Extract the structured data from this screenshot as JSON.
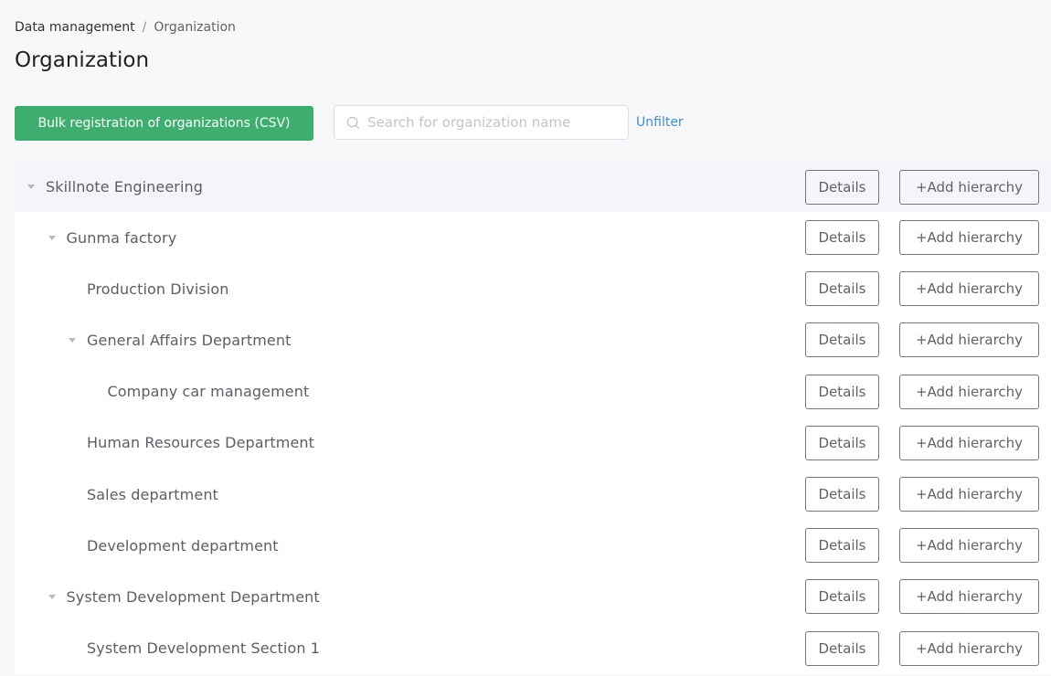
{
  "breadcrumb": {
    "items": [
      {
        "label": "Data management"
      },
      {
        "label": "Organization"
      }
    ],
    "separator": "/"
  },
  "page": {
    "title": "Organization"
  },
  "toolbar": {
    "bulk_register_label": "Bulk registration of organizations (CSV)",
    "search_placeholder": "Search for organization name",
    "search_value": "",
    "unfilter_label": "Unfilter"
  },
  "colors": {
    "primary_green": "#3dae6e",
    "link_blue": "#3d8fd6",
    "page_background": "#f7f8fa"
  },
  "tree": {
    "details_label": "Details",
    "add_hierarchy_label": "+Add hierarchy",
    "nodes": [
      {
        "label": "Skillnote Engineering",
        "level": 0,
        "expandable": true,
        "expanded": true
      },
      {
        "label": "Gunma factory",
        "level": 1,
        "expandable": true,
        "expanded": true
      },
      {
        "label": "Production Division",
        "level": 2,
        "expandable": false
      },
      {
        "label": "General Affairs Department",
        "level": 2,
        "expandable": true,
        "expanded": true
      },
      {
        "label": "Company car management",
        "level": 3,
        "expandable": false
      },
      {
        "label": "Human Resources Department",
        "level": 2,
        "expandable": false
      },
      {
        "label": "Sales department",
        "level": 2,
        "expandable": false
      },
      {
        "label": "Development department",
        "level": 2,
        "expandable": false
      },
      {
        "label": "System Development Department",
        "level": 1,
        "expandable": true,
        "expanded": true
      },
      {
        "label": "System Development Section 1",
        "level": 2,
        "expandable": false
      }
    ]
  }
}
